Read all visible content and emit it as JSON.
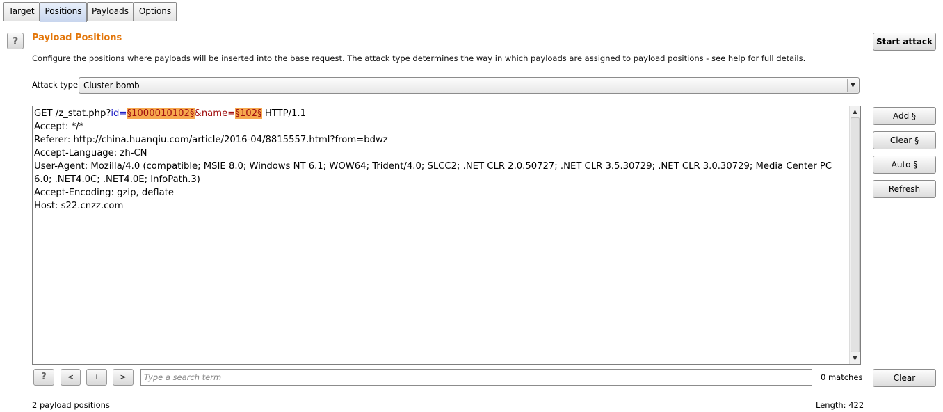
{
  "tabs": [
    {
      "label": "Target"
    },
    {
      "label": "Positions"
    },
    {
      "label": "Payloads"
    },
    {
      "label": "Options"
    }
  ],
  "active_tab": "Positions",
  "header": {
    "help_label": "?",
    "title": "Payload Positions",
    "description": "Configure the positions where payloads will be inserted into the base request. The attack type determines the way in which payloads are assigned to payload positions - see help for full details."
  },
  "start_attack_label": "Start attack",
  "attack_type": {
    "label": "Attack type:",
    "value": "Cluster bomb",
    "arrow": "▼"
  },
  "request": {
    "line1_pre": "GET /z_stat.php?",
    "param_id": "id=",
    "payload_id": "§1000010102§",
    "param_name": "&name=",
    "payload_name": "§102§",
    "line1_post": " HTTP/1.1",
    "accept": "Accept: */*",
    "referer": "Referer: http://china.huanqiu.com/article/2016-04/8815557.html?from=bdwz",
    "accept_language": "Accept-Language: zh-CN",
    "user_agent": "User-Agent: Mozilla/4.0 (compatible; MSIE 8.0; Windows NT 6.1; WOW64; Trident/4.0; SLCC2; .NET CLR 2.0.50727; .NET CLR 3.5.30729; .NET CLR 3.0.30729; Media Center PC 6.0; .NET4.0C; .NET4.0E; InfoPath.3)",
    "accept_encoding": "Accept-Encoding: gzip, deflate",
    "host": "Host: s22.cnzz.com"
  },
  "side_buttons": {
    "add": "Add §",
    "clear": "Clear §",
    "auto": "Auto §",
    "refresh": "Refresh"
  },
  "search": {
    "help_label": "?",
    "prev_label": "<",
    "add_label": "+",
    "next_label": ">",
    "placeholder": "Type a search term",
    "matches": "0 matches",
    "clear_label": "Clear"
  },
  "footer": {
    "positions": "2 payload positions",
    "length": "Length: 422"
  },
  "scroll": {
    "up": "▲",
    "down": "▼"
  },
  "colors": {
    "title": "#e3760a",
    "payload_highlight": "#f6a84e",
    "param_blue": "#1d1dc4",
    "param_red": "#a01010"
  }
}
